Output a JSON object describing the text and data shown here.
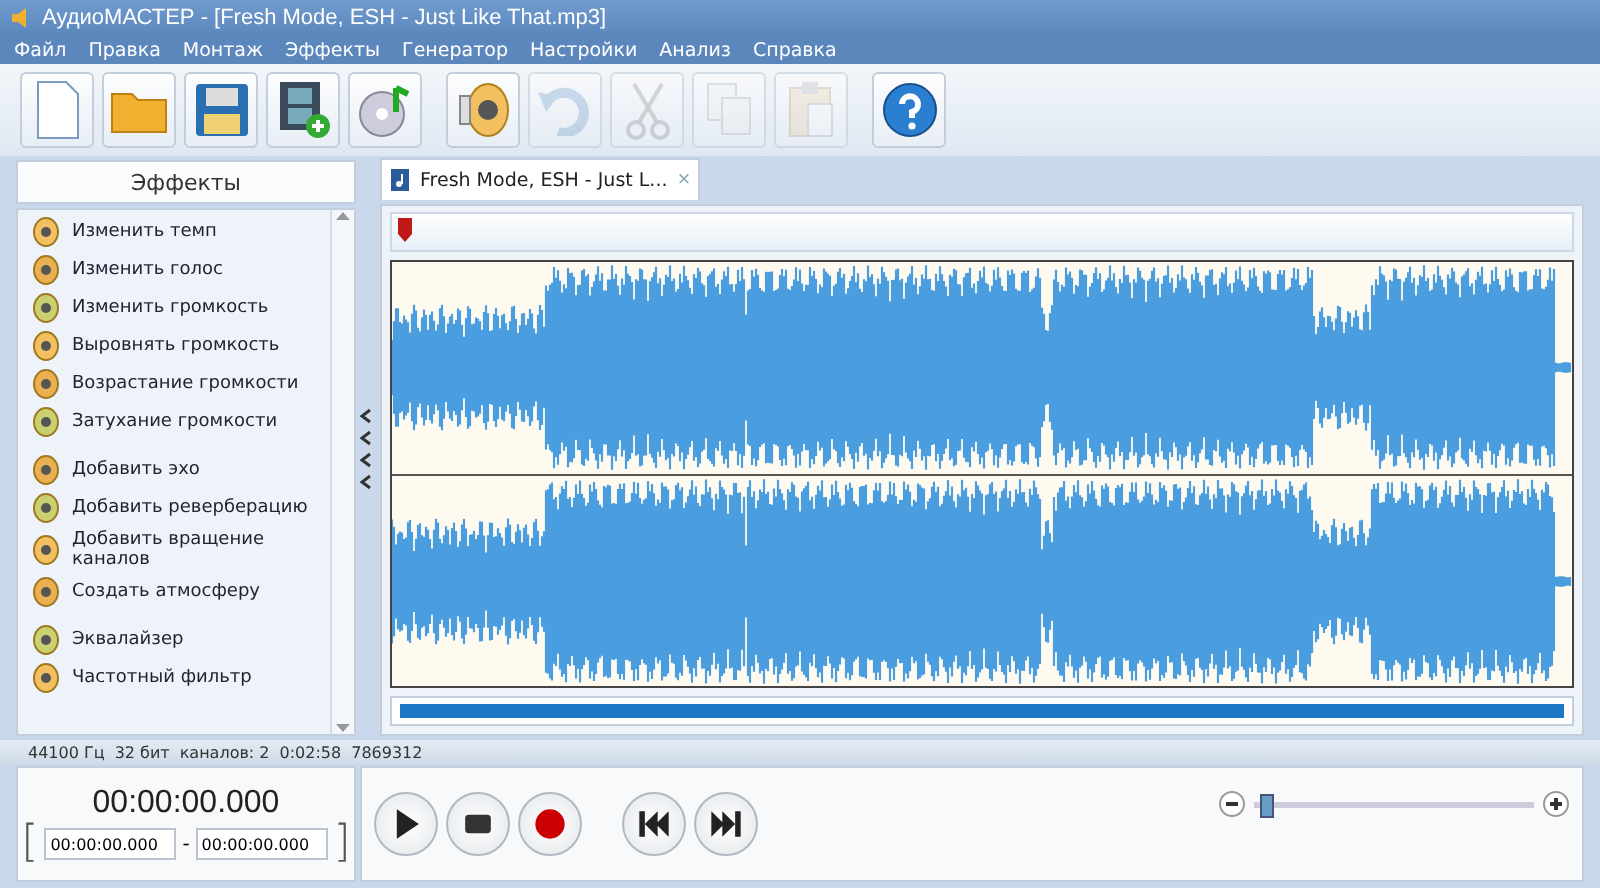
{
  "window": {
    "title": "АудиоМАСТЕР - [Fresh Mode, ESH - Just Like That.mp3]"
  },
  "menu": [
    "Файл",
    "Правка",
    "Монтаж",
    "Эффекты",
    "Генератор",
    "Настройки",
    "Анализ",
    "Справка"
  ],
  "toolbar": [
    [
      {
        "kind": "new",
        "disabled": false
      },
      {
        "kind": "open",
        "disabled": false
      },
      {
        "kind": "save",
        "disabled": false
      },
      {
        "kind": "video",
        "disabled": false
      },
      {
        "kind": "cd",
        "disabled": false
      }
    ],
    [
      {
        "kind": "volume",
        "disabled": false
      },
      {
        "kind": "undo",
        "disabled": true
      },
      {
        "kind": "cut",
        "disabled": true
      },
      {
        "kind": "copy",
        "disabled": true
      },
      {
        "kind": "paste",
        "disabled": true
      }
    ],
    [
      {
        "kind": "help",
        "disabled": false
      }
    ]
  ],
  "effects_panel": {
    "title": "Эффекты",
    "groups": [
      [
        "Изменить темп",
        "Изменить голос",
        "Изменить громкость",
        "Выровнять громкость",
        "Возрастание громкости",
        "Затухание громкости"
      ],
      [
        "Добавить эхо",
        "Добавить реверберацию",
        "Добавить вращение каналов",
        "Создать атмосферу"
      ],
      [
        "Эквалайзер",
        "Частотный фильтр"
      ]
    ]
  },
  "tabs": [
    {
      "label": "Fresh Mode, ESH - Just L...",
      "close": "×",
      "selected": true
    }
  ],
  "status_bar": [
    "44100 Гц",
    "32 бит",
    "каналов: 2",
    "0:02:58",
    "7869312"
  ],
  "time_display": "00:00:00.000",
  "range": {
    "open": "[",
    "start": "00:00:00.000",
    "separator": "-",
    "end": "00:00:00.000",
    "close": "]"
  },
  "transport": [
    {
      "kind": "play"
    },
    {
      "kind": "stop"
    },
    {
      "kind": "record"
    },
    {
      "kind": "rewind"
    },
    {
      "kind": "forward"
    }
  ],
  "zoom": {
    "level": 0.02
  }
}
